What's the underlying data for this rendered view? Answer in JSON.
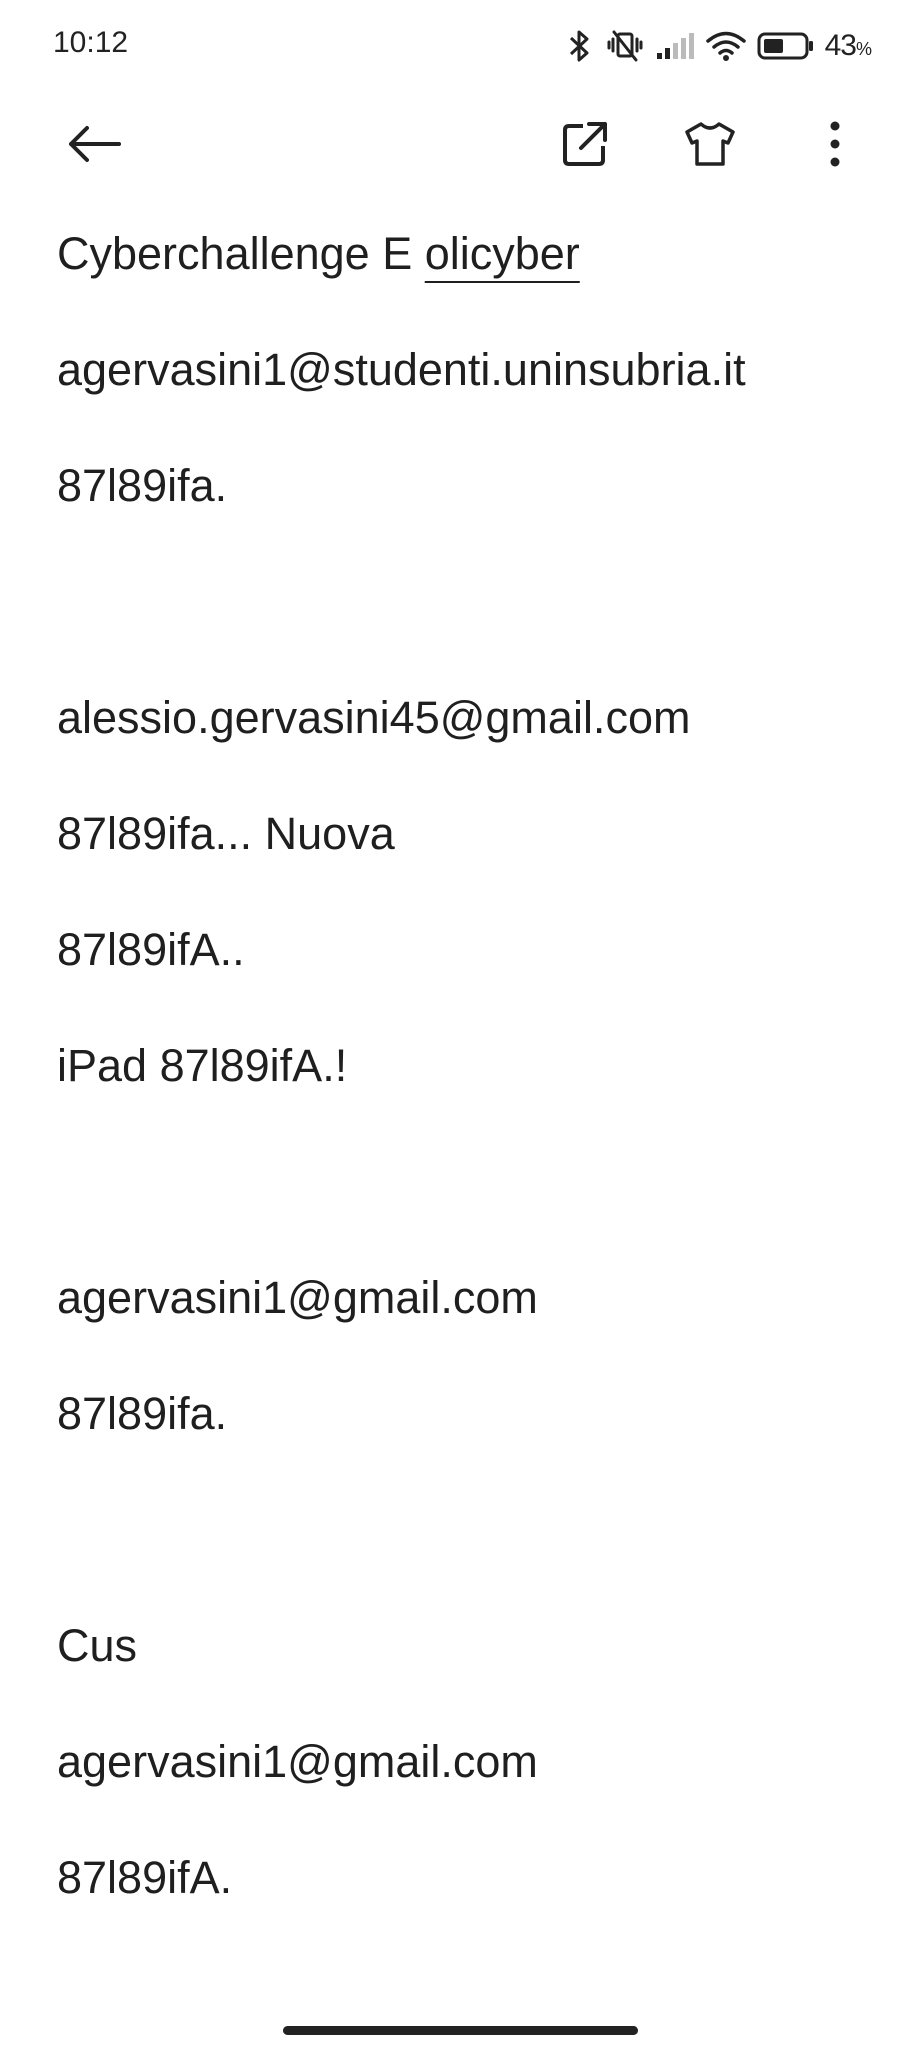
{
  "status_bar": {
    "time": "10:12",
    "battery_percent": "43",
    "battery_unit": "%",
    "icons": [
      "bluetooth-icon",
      "vibrate-icon",
      "cellular-signal-icon",
      "wifi-icon",
      "battery-icon"
    ]
  },
  "toolbar": {
    "icons": [
      "back-arrow-icon",
      "open-external-icon",
      "theme-shirt-icon",
      "more-vert-icon"
    ]
  },
  "note": {
    "title_prefix": "Cyberchallenge E ",
    "title_link": "olicyber",
    "lines": [
      "agervasini1@studenti.uninsubria.it",
      "87l89ifa.",
      "",
      "alessio.gervasini45@gmail.com",
      "87l89ifa... Nuova",
      "87l89ifA..",
      "iPad 87l89ifA.!",
      "",
      "agervasini1@gmail.com",
      "87l89ifa.",
      "",
      "Cus",
      "agervasini1@gmail.com",
      "87l89ifA."
    ]
  },
  "colors": {
    "text": "#1f1f1f",
    "background": "#ffffff"
  }
}
